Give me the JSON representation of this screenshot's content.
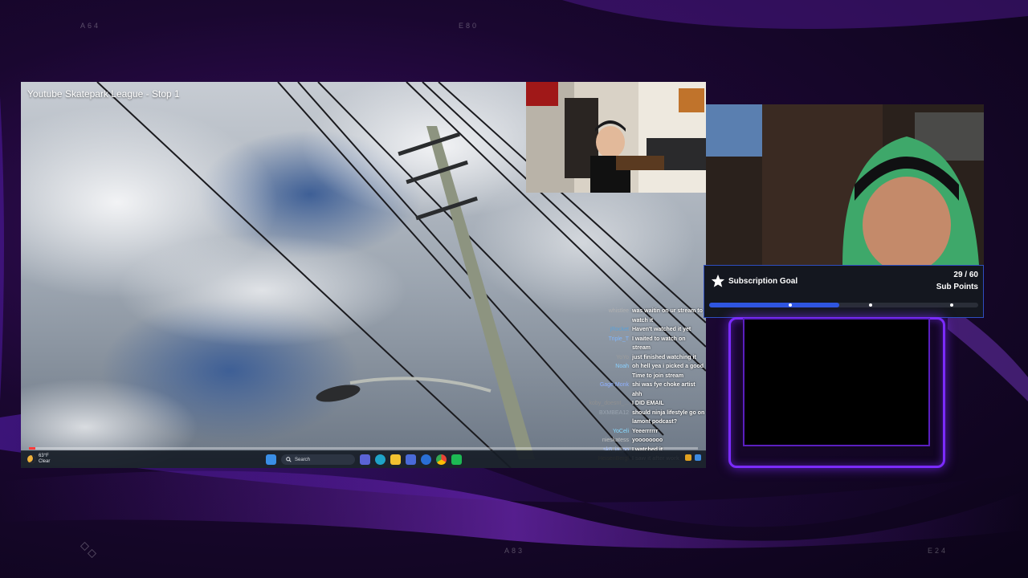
{
  "overlay": {
    "corner_codes": [
      "A64",
      "E80",
      "A83",
      "E24"
    ]
  },
  "video": {
    "title": "Youtube Skatepark League - Stop 1",
    "progress": 0.01
  },
  "taskbar": {
    "weather_temp": "63°F",
    "weather_cond": "Clear",
    "search_placeholder": "Search",
    "app_icons": [
      "start-icon",
      "search-icon",
      "teams-icon",
      "edge-icon",
      "files-icon",
      "store-icon",
      "mail-icon",
      "chrome-icon",
      "spotify-icon"
    ]
  },
  "chat": {
    "messages": [
      {
        "user": "whistlee",
        "color": "#b0b0b0",
        "text": "was waitin on ur stream to watch it"
      },
      {
        "user": "jRocket",
        "color": "#5aa0d8",
        "text": "Haven't watched it yet"
      },
      {
        "user": "Triple_T",
        "color": "#7fb6ff",
        "text": "I waited to watch on stream"
      },
      {
        "user": "YoYo",
        "color": "#9c9c9c",
        "text": "just finished watching it"
      },
      {
        "user": "Noah",
        "color": "#8ad0ff",
        "text": "oh hell yea i picked a good Time to join stream"
      },
      {
        "user": "Gage Monk",
        "color": "#8fb0ff",
        "text": "shi was fye choke artist ahh"
      },
      {
        "user": "koby_doesnt_...",
        "color": "#909090",
        "text": "I DID EMAIL"
      },
      {
        "user": "BXMBEA12",
        "color": "#9aa4b0",
        "text": "should ninja lifestyle go on lamont podcast?"
      },
      {
        "user": "YoCeli",
        "color": "#86d9ff",
        "text": "Yeeerrrrrr"
      },
      {
        "user": "nieskatess",
        "color": "#c0c0c0",
        "text": "yoooooooo"
      },
      {
        "user": "sk8_ja_po",
        "color": "#a9c4ff",
        "text": "I watched it"
      },
      {
        "user": "HeisenBergl",
        "color": "#ffd27a",
        "text": "I saw it after work"
      }
    ]
  },
  "sub_goal": {
    "label": "Subscription Goal",
    "count": "29 / 60",
    "unit": "Sub Points",
    "current": 29,
    "target": 60,
    "bar_color": "#2f56e0",
    "markers": [
      0.3,
      0.6,
      0.9
    ]
  },
  "colors": {
    "frame_accent": "#7b2bff",
    "goal_border": "#2e4ec0"
  }
}
